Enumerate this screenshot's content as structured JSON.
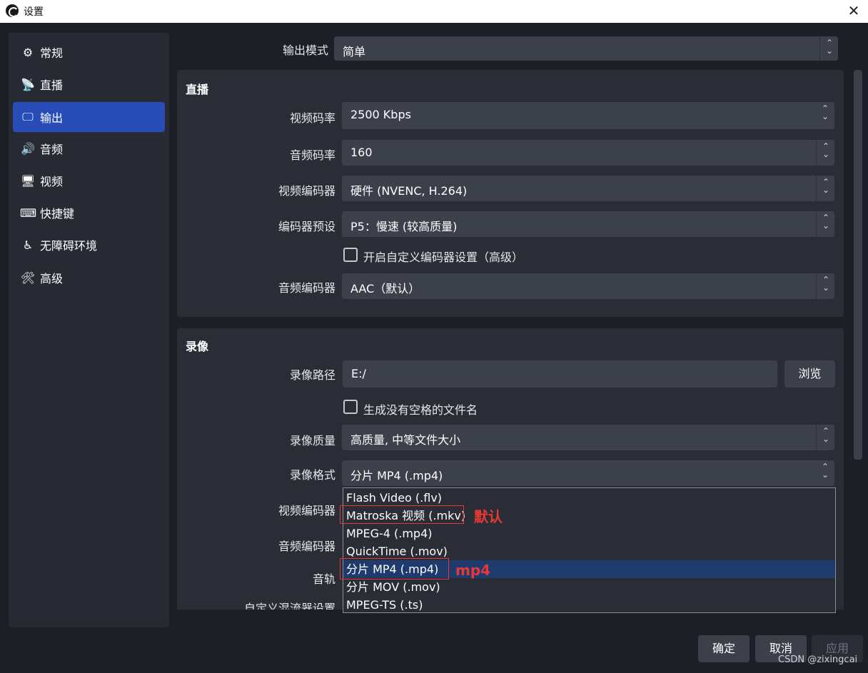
{
  "window": {
    "title": "设置",
    "close_glyph": "✕"
  },
  "sidebar": {
    "items": [
      {
        "label": "常规",
        "icon": "gear-icon",
        "glyph": "⚙"
      },
      {
        "label": "直播",
        "icon": "broadcast-antenna-icon",
        "glyph": "📡"
      },
      {
        "label": "输出",
        "icon": "output-monitor-icon",
        "glyph": "🖵"
      },
      {
        "label": "音频",
        "icon": "speaker-icon",
        "glyph": "🔊"
      },
      {
        "label": "视频",
        "icon": "monitor-icon",
        "glyph": "🖥"
      },
      {
        "label": "快捷键",
        "icon": "keyboard-icon",
        "glyph": "⌨"
      },
      {
        "label": "无障碍环境",
        "icon": "accessibility-icon",
        "glyph": "♿"
      },
      {
        "label": "高级",
        "icon": "tools-icon",
        "glyph": "🛠"
      }
    ],
    "active_index": 2
  },
  "output_mode": {
    "label": "输出模式",
    "value": "简单"
  },
  "streaming": {
    "title": "直播",
    "video_bitrate": {
      "label": "视频码率",
      "value": "2500 Kbps"
    },
    "audio_bitrate": {
      "label": "音频码率",
      "value": "160"
    },
    "video_encoder": {
      "label": "视频编码器",
      "value": "硬件 (NVENC, H.264)"
    },
    "encoder_preset": {
      "label": "编码器预设",
      "value": "P5：慢速 (较高质量)"
    },
    "custom_encoder": {
      "label": "开启自定义编码器设置（高级）",
      "checked": false
    },
    "audio_encoder": {
      "label": "音频编码器",
      "value": "AAC（默认）"
    }
  },
  "recording": {
    "title": "录像",
    "path": {
      "label": "录像路径",
      "value": "E:/"
    },
    "browse_button": "浏览",
    "no_space_filename": {
      "label": "生成没有空格的文件名",
      "checked": false
    },
    "quality": {
      "label": "录像质量",
      "value": "高质量, 中等文件大小"
    },
    "format": {
      "label": "录像格式",
      "value": "分片 MP4 (.mp4)"
    },
    "video_encoder_label": "视频编码器",
    "audio_encoder_label": "音频编码器",
    "tracks_label": "音轨",
    "custom_muxer_label": "自定义混流器设置"
  },
  "format_dropdown": {
    "options": [
      "Flash Video (.flv)",
      "Matroska 视频 (.mkv)",
      "MPEG-4 (.mp4)",
      "QuickTime (.mov)",
      "分片 MP4 (.mp4)",
      "分片 MOV (.mov)",
      "MPEG-TS (.ts)"
    ],
    "highlighted_index": 4
  },
  "annotations": {
    "mkv_note": "默认",
    "mp4_note": "mp4"
  },
  "buttons": {
    "ok": "确定",
    "cancel": "取消",
    "apply": "应用"
  },
  "watermark": "CSDN @zixingcai"
}
